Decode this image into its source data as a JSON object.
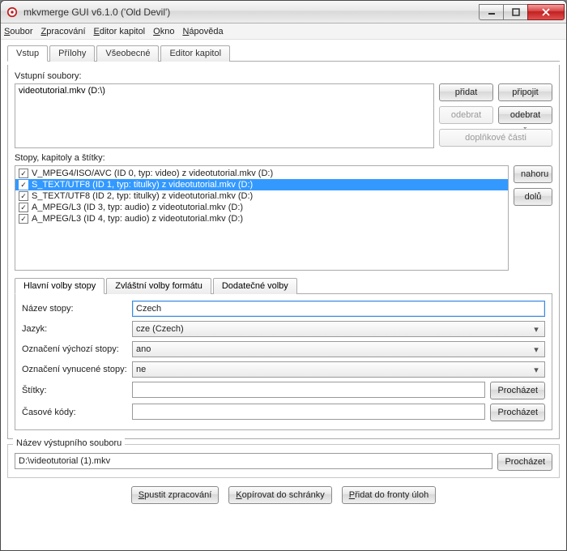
{
  "window_title": "mkvmerge GUI v6.1.0 ('Old Devil')",
  "menus": [
    "Soubor",
    "Zpracování",
    "Editor kapitol",
    "Okno",
    "Nápověda"
  ],
  "tabs": {
    "input": "Vstup",
    "attachments": "Přílohy",
    "global": "Všeobecné",
    "chapters": "Editor kapitol"
  },
  "input_files_label": "Vstupní soubory:",
  "input_files": [
    "videotutorial.mkv (D:\\)"
  ],
  "btn_add": "přidat",
  "btn_append": "připojit",
  "btn_remove": "odebrat",
  "btn_remove_all": "odebrat vše",
  "btn_addparts": "doplňkové části",
  "tracks_label": "Stopy, kapitoly a štítky:",
  "tracks": [
    {
      "checked": true,
      "selected": false,
      "text": "V_MPEG4/ISO/AVC (ID 0, typ: video) z videotutorial.mkv (D:)"
    },
    {
      "checked": true,
      "selected": true,
      "text": "S_TEXT/UTF8 (ID 1, typ: titulky) z videotutorial.mkv (D:)"
    },
    {
      "checked": true,
      "selected": false,
      "text": "S_TEXT/UTF8 (ID 2, typ: titulky) z videotutorial.mkv (D:)"
    },
    {
      "checked": true,
      "selected": false,
      "text": "A_MPEG/L3 (ID 3, typ: audio) z videotutorial.mkv (D:)"
    },
    {
      "checked": true,
      "selected": false,
      "text": "A_MPEG/L3 (ID 4, typ: audio) z videotutorial.mkv (D:)"
    }
  ],
  "btn_up": "nahoru",
  "btn_down": "dolů",
  "inner_tabs": {
    "main": "Hlavní volby stopy",
    "format": "Zvláštní volby formátu",
    "extra": "Dodatečné volby"
  },
  "track_opts": {
    "name_label": "Název stopy:",
    "name_value": "Czech",
    "lang_label": "Jazyk:",
    "lang_value": "cze (Czech)",
    "default_label": "Označení výchozí stopy:",
    "default_value": "ano",
    "forced_label": "Označení vynucené stopy:",
    "forced_value": "ne",
    "tags_label": "Štítky:",
    "tags_value": "",
    "timecodes_label": "Časové kódy:",
    "timecodes_value": "",
    "browse": "Procházet"
  },
  "output_label": "Název výstupního souboru",
  "output_value": "D:\\videotutorial (1).mkv",
  "btn_start": "Spustit zpracování",
  "btn_copy": "Kopírovat do schránky",
  "btn_queue": "Přidat do fronty úloh"
}
